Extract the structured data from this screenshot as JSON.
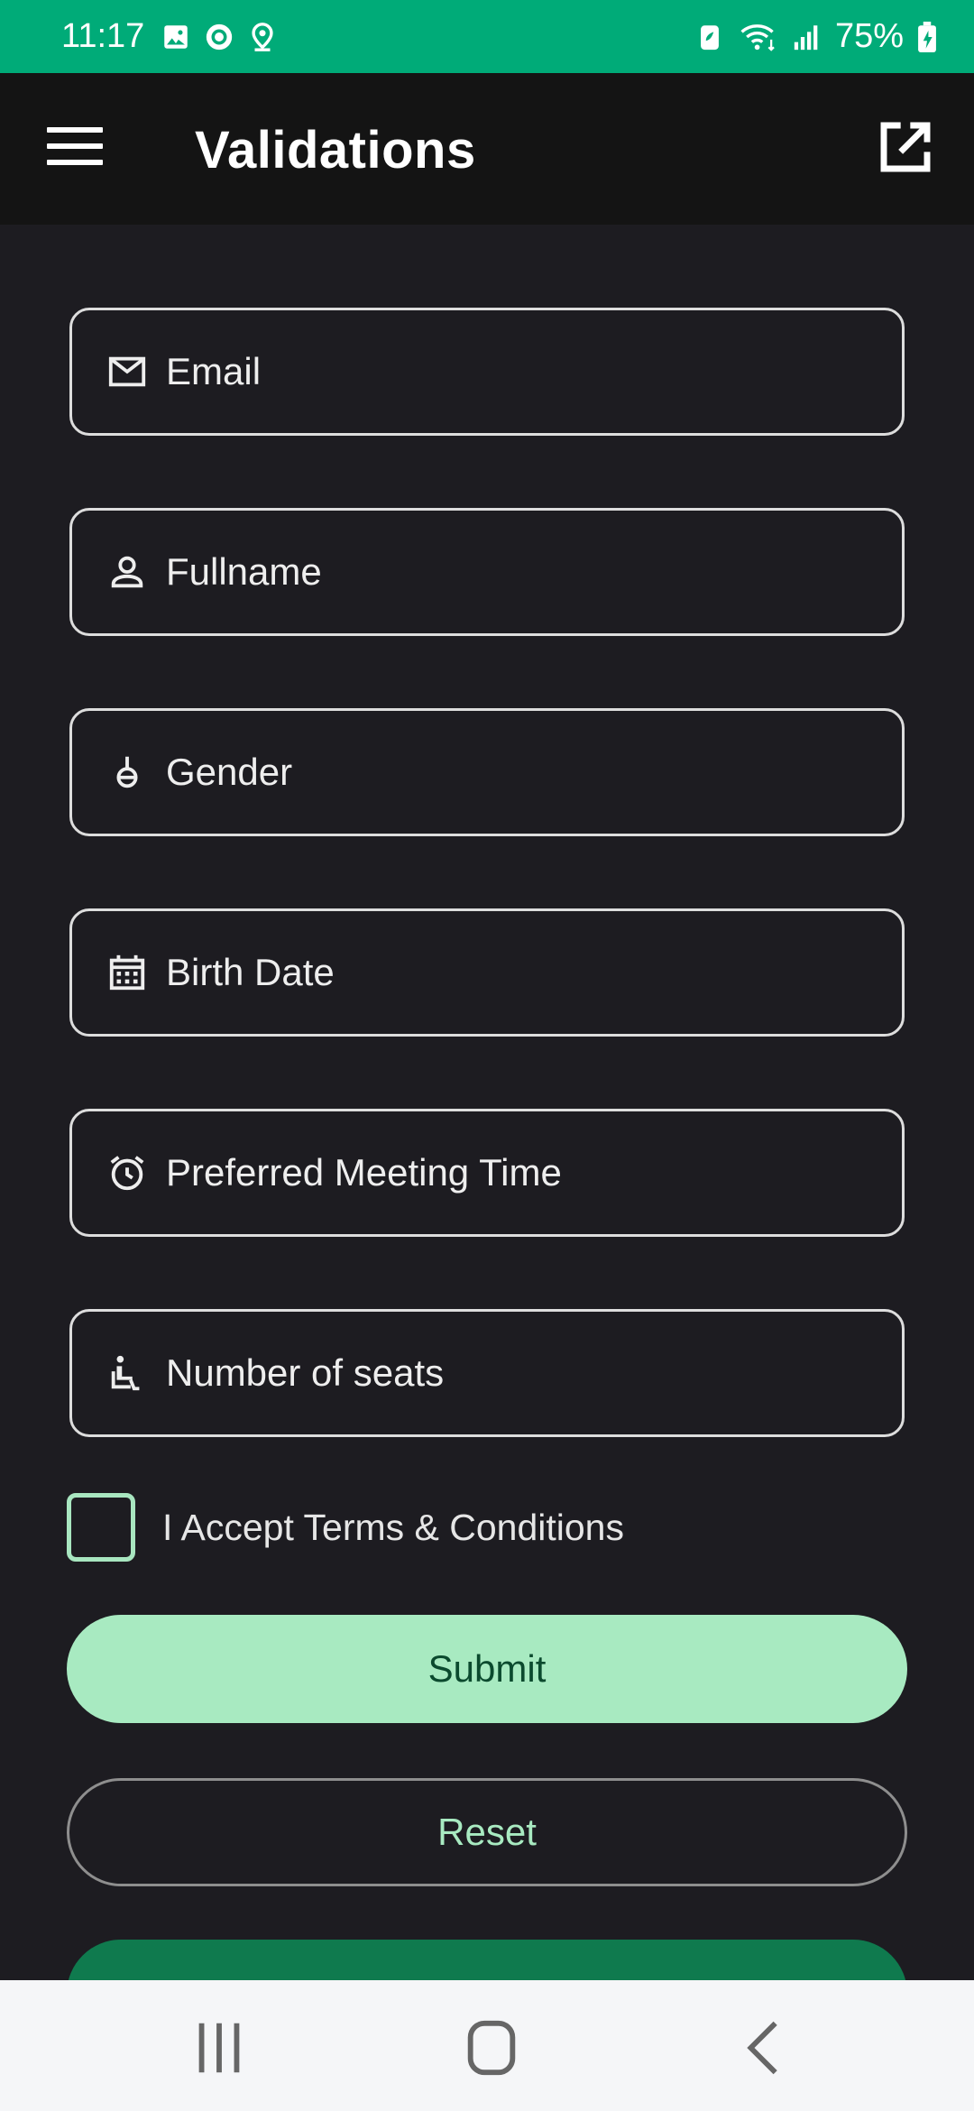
{
  "status_bar": {
    "time": "11:17",
    "battery": "75%",
    "left_icons": [
      "image-icon",
      "record-icon",
      "location-icon"
    ],
    "right_icons": [
      "battery-saver-icon",
      "wifi-icon",
      "signal-icon",
      "battery-charging-icon"
    ]
  },
  "app_bar": {
    "title": "Validations",
    "menu_icon": "hamburger-menu-icon",
    "action_icon": "open-in-new-icon"
  },
  "form": {
    "fields": [
      {
        "label": "Email",
        "icon": "mail-icon"
      },
      {
        "label": "Fullname",
        "icon": "person-icon"
      },
      {
        "label": "Gender",
        "icon": "gender-icon"
      },
      {
        "label": "Birth Date",
        "icon": "calendar-icon"
      },
      {
        "label": "Preferred Meeting Time",
        "icon": "alarm-icon"
      },
      {
        "label": "Number of seats",
        "icon": "seat-icon"
      }
    ],
    "terms_label": "I Accept Terms & Conditions",
    "terms_checked": false,
    "submit_label": "Submit",
    "reset_label": "Reset"
  },
  "colors": {
    "status_bar": "#00ab78",
    "app_bar": "#141414",
    "background": "#1d1c21",
    "accent": "#a8eac1",
    "accent_dark": "#0f7a4e"
  },
  "nav_bar": {
    "icons": [
      "recent-apps-icon",
      "home-icon",
      "back-icon"
    ]
  }
}
